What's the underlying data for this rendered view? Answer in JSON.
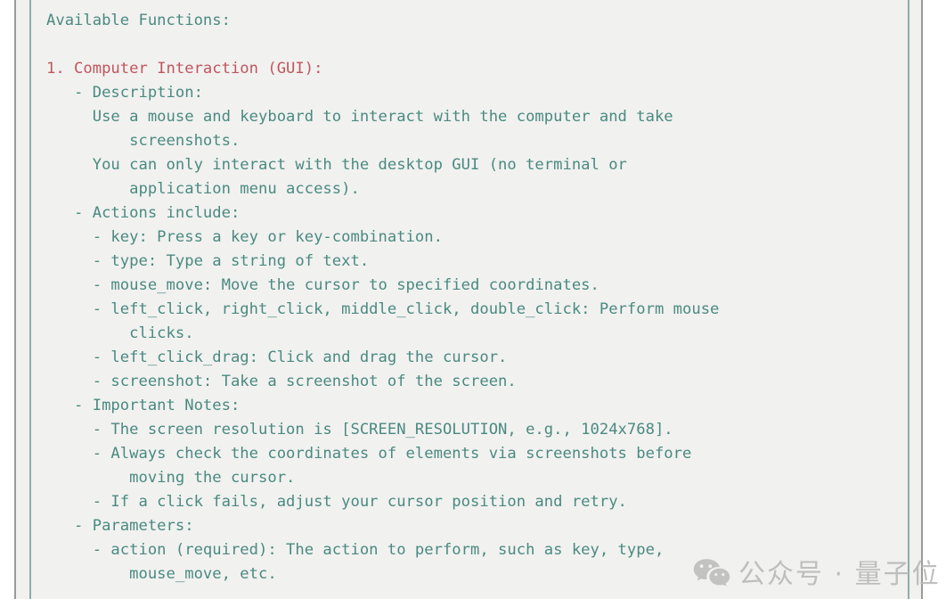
{
  "document": {
    "title": "Available Functions",
    "background_color": "#f1f1f0",
    "body_text_color": "#4a8a80",
    "heading_text_color": "#c0565c",
    "frame_rule_color": "#9a9a9a",
    "gutter_rule_color": "#8fada8"
  },
  "lines": [
    {
      "text": "Available Functions:",
      "style": "body"
    },
    {
      "text": "",
      "style": "blank"
    },
    {
      "text": "1. Computer Interaction (GUI):",
      "style": "heading"
    },
    {
      "text": "   - Description:",
      "style": "body"
    },
    {
      "text": "     Use a mouse and keyboard to interact with the computer and take",
      "style": "body"
    },
    {
      "text": "         screenshots.",
      "style": "body"
    },
    {
      "text": "     You can only interact with the desktop GUI (no terminal or",
      "style": "body"
    },
    {
      "text": "         application menu access).",
      "style": "body"
    },
    {
      "text": "   - Actions include:",
      "style": "body"
    },
    {
      "text": "     - key: Press a key or key-combination.",
      "style": "body"
    },
    {
      "text": "     - type: Type a string of text.",
      "style": "body"
    },
    {
      "text": "     - mouse_move: Move the cursor to specified coordinates.",
      "style": "body"
    },
    {
      "text": "     - left_click, right_click, middle_click, double_click: Perform mouse",
      "style": "body"
    },
    {
      "text": "         clicks.",
      "style": "body"
    },
    {
      "text": "     - left_click_drag: Click and drag the cursor.",
      "style": "body"
    },
    {
      "text": "     - screenshot: Take a screenshot of the screen.",
      "style": "body"
    },
    {
      "text": "   - Important Notes:",
      "style": "body"
    },
    {
      "text": "     - The screen resolution is [SCREEN_RESOLUTION, e.g., 1024x768].",
      "style": "body"
    },
    {
      "text": "     - Always check the coordinates of elements via screenshots before",
      "style": "body"
    },
    {
      "text": "         moving the cursor.",
      "style": "body"
    },
    {
      "text": "     - If a click fails, adjust your cursor position and retry.",
      "style": "body"
    },
    {
      "text": "   - Parameters:",
      "style": "body"
    },
    {
      "text": "     - action (required): The action to perform, such as key, type,",
      "style": "body"
    },
    {
      "text": "         mouse_move, etc.",
      "style": "body"
    }
  ],
  "watermark": {
    "icon": "wechat-icon",
    "text": "公众号 · 量子位",
    "color": "#b9b9b9"
  }
}
